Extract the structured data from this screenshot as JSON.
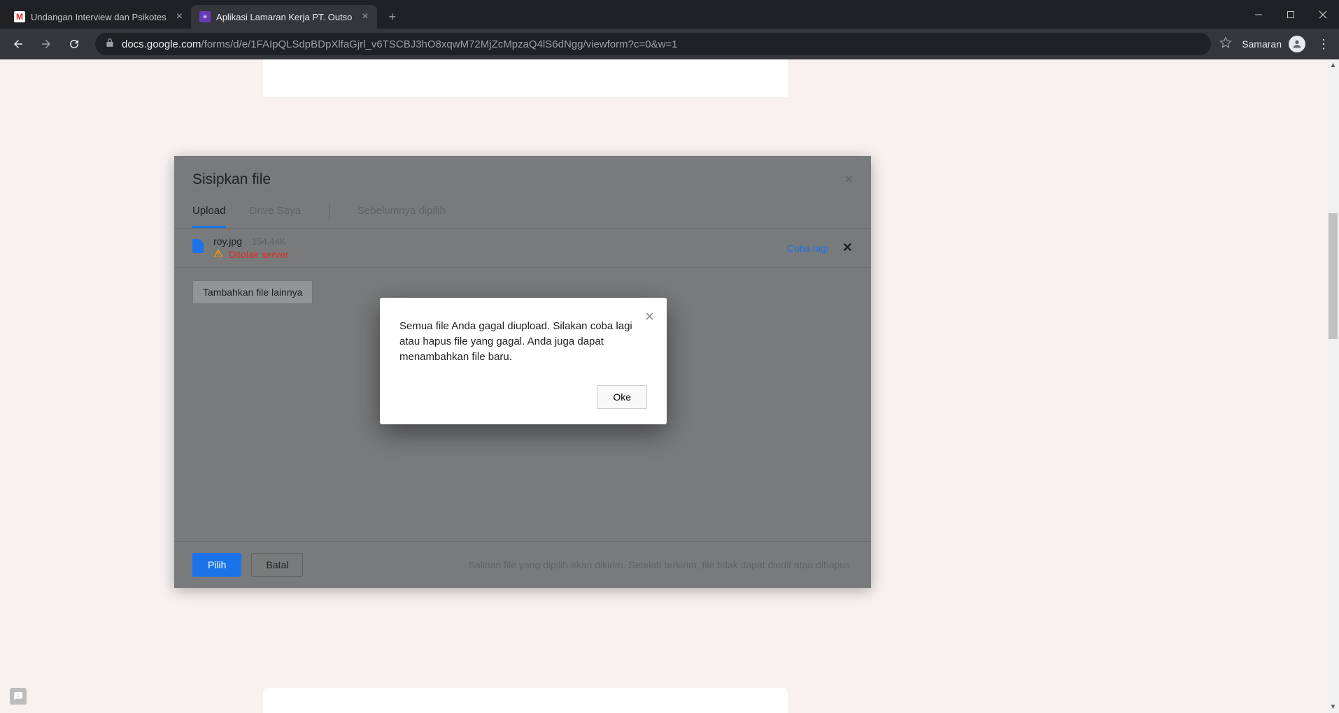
{
  "browser": {
    "tabs": [
      {
        "title": "Undangan Interview dan Psikotes",
        "favicon": "gmail",
        "active": false
      },
      {
        "title": "Aplikasi Lamaran Kerja PT. Outso",
        "favicon": "forms",
        "active": true
      }
    ],
    "url_host": "docs.google.com",
    "url_path": "/forms/d/e/1FAIpQLSdpBDpXlfaGjrl_v6TSCBJ3hO8xqwM72MjZcMpzaQ4lS6dNgg/viewform?c=0&w=1",
    "profile_name": "Samaran"
  },
  "picker": {
    "title": "Sisipkan file",
    "tabs": {
      "upload": "Upload",
      "my_drive": "Drive Saya",
      "previous": "Sebelumnya dipilih"
    },
    "file": {
      "name": "roy.jpg",
      "size": "154.44K",
      "error": "Ditolak server",
      "retry": "Coba lagi"
    },
    "add_more": "Tambahkan file lainnya",
    "footer": {
      "select": "Pilih",
      "cancel": "Batal",
      "note": "Salinan file yang dipilih akan dikirim. Setelah terkirim, file tidak dapat diedit atau dihapus."
    }
  },
  "alert": {
    "message": "Semua file Anda gagal diupload. Silakan coba lagi atau hapus file yang gagal. Anda juga dapat menambahkan file baru.",
    "ok": "Oke"
  }
}
